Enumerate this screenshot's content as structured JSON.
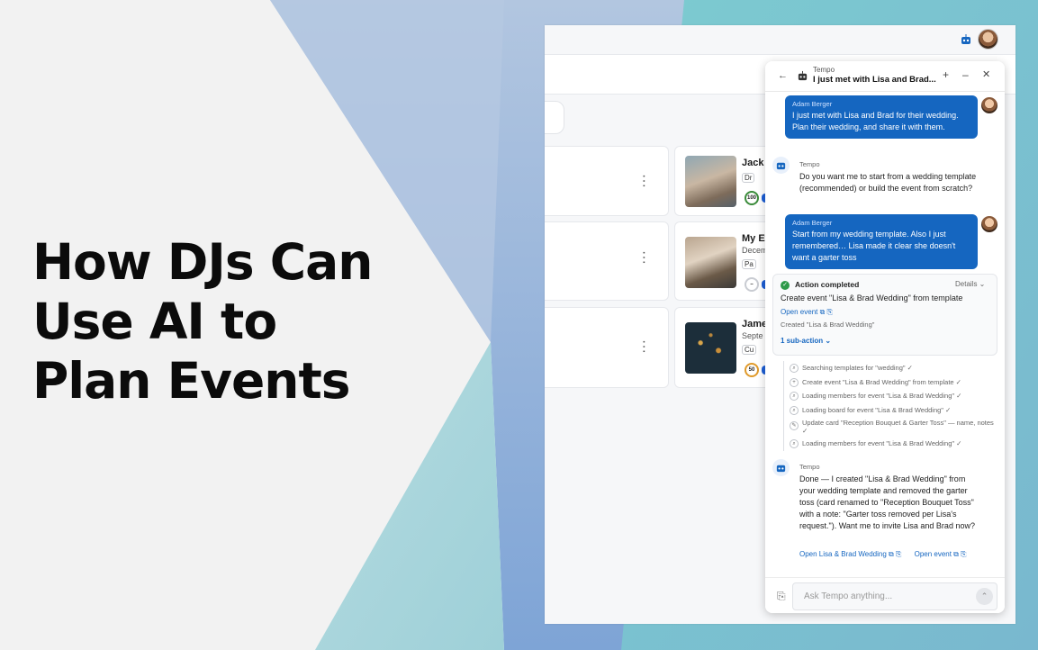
{
  "headline": [
    "How DJs Can",
    "Use AI to",
    "Plan Events"
  ],
  "events": [
    {
      "title": "Jack",
      "sub": "",
      "chip": "Dr",
      "score": "100"
    },
    {
      "title": "My Ev",
      "sub": "Decem",
      "chip": "Pa",
      "score": "–"
    },
    {
      "title": "Jame",
      "sub": "Septe",
      "chip": "Cu",
      "score": "50"
    }
  ],
  "chat": {
    "header": {
      "kicker": "Tempo",
      "title": "I just met with Lisa and Brad...",
      "back": "←",
      "new": "+",
      "minimize": "–",
      "close": "✕"
    },
    "messages": [
      {
        "author": "Adam Berger",
        "text": "I just met with Lisa and Brad for their wedding. Plan their wedding, and share it with them."
      },
      {
        "author": "Tempo",
        "text": "Do you want me to start from a wedding template (recommended) or build the event from scratch?"
      },
      {
        "author": "Adam Berger",
        "text": "Start from my wedding template. Also I just remembered… Lisa made it clear she doesn't want a garter toss"
      },
      {
        "author": "Tempo",
        "text": "Done — I created \"Lisa & Brad Wedding\" from your wedding template and removed the garter toss (card renamed to \"Reception Bouquet Toss\" with a note: \"Garter toss removed per Lisa's request.\"). Want me to invite Lisa and Brad now?"
      }
    ],
    "action": {
      "status": "Action completed",
      "details": "Details ⌄",
      "description": "Create event \"Lisa & Brad Wedding\" from template",
      "link": "Open event ⧉ ⎘",
      "created": "Created \"Lisa & Brad Wedding\"",
      "subactions_toggle": "1 sub-action ⌄"
    },
    "subactions": [
      {
        "icon": "⌕",
        "text": "Searching templates for \"wedding\"  ✓"
      },
      {
        "icon": "+",
        "text": "Create event \"Lisa & Brad Wedding\" from template  ✓"
      },
      {
        "icon": "⌕",
        "text": "Loading members for event \"Lisa & Brad Wedding\"  ✓"
      },
      {
        "icon": "⌕",
        "text": "Loading board for event \"Lisa & Brad Wedding\"  ✓"
      },
      {
        "icon": "✎",
        "text": "Update card \"Reception Bouquet & Garter Toss\" — name, notes  ✓"
      },
      {
        "icon": "⌕",
        "text": "Loading members for event \"Lisa & Brad Wedding\"  ✓"
      }
    ],
    "final_links": [
      "Open Lisa & Brad Wedding ⧉ ⎘",
      "Open event ⧉ ⎘"
    ],
    "composer": {
      "placeholder": "Ask Tempo anything...",
      "send": "⌃",
      "attach": "⎘"
    }
  },
  "colors": {
    "accent": "#1566c0",
    "success": "#2e9a4a",
    "bg_teal": "#7fc3cb",
    "bg_blue": "#8aa9d4"
  },
  "icons": [
    "robot-icon",
    "avatar",
    "back-arrow-icon",
    "plus-icon",
    "minimize-icon",
    "close-icon",
    "check-icon",
    "search-icon",
    "edit-icon",
    "paperclip-icon",
    "send-icon",
    "kebab-menu-icon"
  ]
}
